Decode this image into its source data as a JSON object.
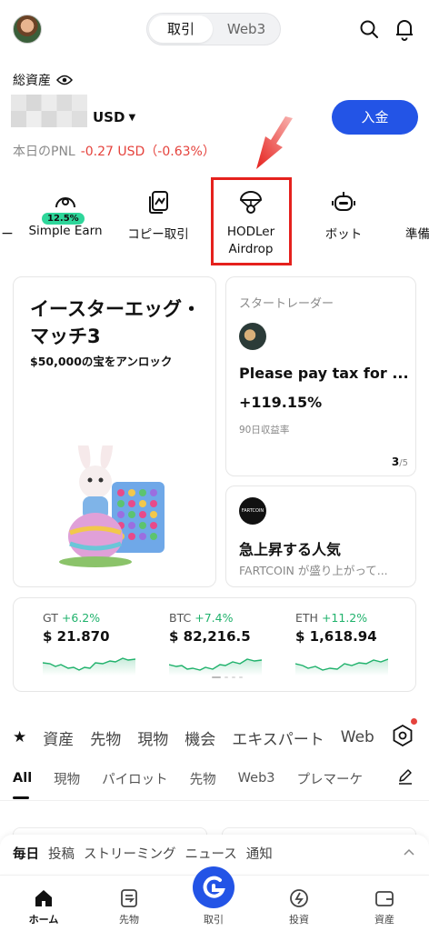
{
  "header": {
    "tabs": [
      "取引",
      "Web3"
    ],
    "active_tab": "取引"
  },
  "balance": {
    "label": "総資産",
    "currency": "USD",
    "deposit_label": "入金",
    "pnl_label": "本日のPNL",
    "pnl_value": "-0.27 USD（-0.63%）"
  },
  "quick_actions": [
    {
      "label": "ー",
      "icon": "partial-icon"
    },
    {
      "label": "Simple Earn",
      "icon": "earn-icon",
      "badge": "12.5%"
    },
    {
      "label": "コピー取引",
      "icon": "copy-trade-icon"
    },
    {
      "label": "HODLer Airdrop",
      "icon": "parachute-icon"
    },
    {
      "label": "ボット",
      "icon": "bot-icon"
    },
    {
      "label": "準備",
      "icon": "reserve-icon"
    }
  ],
  "promo": {
    "title": "イースターエッグ・マッチ3",
    "subtitle": "$50,000の宝をアンロック"
  },
  "star_trader": {
    "label": "スタートレーダー",
    "name": "Please pay tax for ...",
    "pct": "+119.15%",
    "sub": "90日収益率",
    "pager_current": "3",
    "pager_total": "/5"
  },
  "trending": {
    "logo_text": "FARTCOIN",
    "title": "急上昇する人気",
    "sub": "FARTCOIN が盛り上がって..."
  },
  "tickers": [
    {
      "name": "GT",
      "change": "+6.2%",
      "price": "$ 21.870"
    },
    {
      "name": "BTC",
      "change": "+7.4%",
      "price": "$ 82,216.5"
    },
    {
      "name": "ETH",
      "change": "+11.2%",
      "price": "$ 1,618.94"
    }
  ],
  "market_tabs": [
    "資産",
    "先物",
    "現物",
    "機会",
    "エキスパート",
    "Web"
  ],
  "filter_tabs": [
    "All",
    "現物",
    "パイロット",
    "先物",
    "Web3",
    "プレマーケ"
  ],
  "news_tabs": [
    "毎日",
    "投稿",
    "ストリーミング",
    "ニュース",
    "通知"
  ],
  "bottom_nav": [
    "ホーム",
    "先物",
    "取引",
    "投資",
    "資産"
  ],
  "colors": {
    "accent": "#2354e6",
    "up": "#20b26c",
    "down": "#e5433d",
    "highlight": "#e5211d"
  }
}
